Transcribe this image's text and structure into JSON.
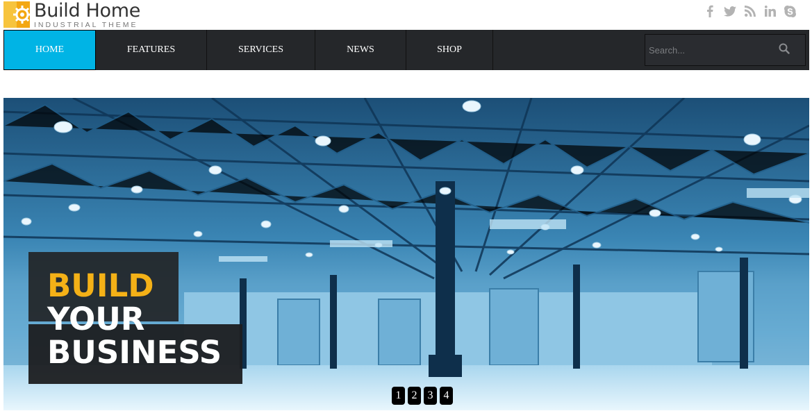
{
  "brand": {
    "title": "Build Home",
    "subtitle": "INDUSTRIAL THEME",
    "accent": "#f4b117"
  },
  "social": [
    "facebook-icon",
    "twitter-icon",
    "rss-icon",
    "linkedin-icon",
    "skype-icon"
  ],
  "nav": {
    "items": [
      {
        "label": "HOME",
        "active": true
      },
      {
        "label": "FEATURES",
        "active": false
      },
      {
        "label": "SERVICES",
        "active": false
      },
      {
        "label": "NEWS",
        "active": false
      },
      {
        "label": "SHOP",
        "active": false
      }
    ],
    "active_color": "#00b4e5",
    "bar_color": "#25272a"
  },
  "search": {
    "placeholder": "Search...",
    "value": ""
  },
  "hero": {
    "line1": "BUILD",
    "line2": "YOUR",
    "line3": "BUSINESS",
    "pager": [
      "1",
      "2",
      "3",
      "4"
    ]
  }
}
